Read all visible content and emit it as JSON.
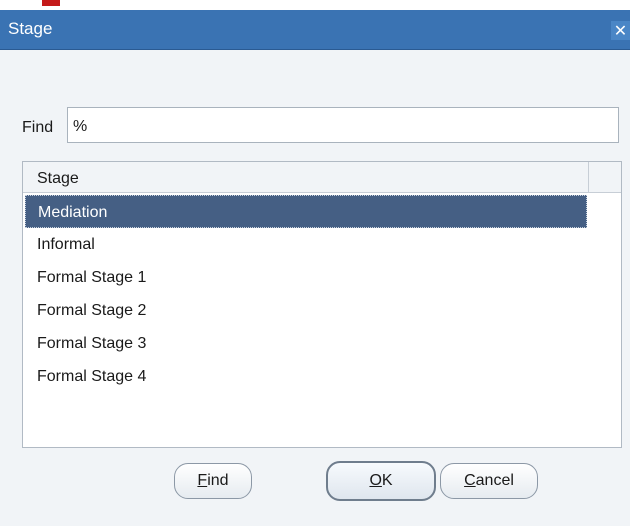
{
  "dialog": {
    "title": "Stage"
  },
  "search": {
    "label": "Find",
    "value": "%"
  },
  "list": {
    "column_header": "Stage",
    "items": [
      "Mediation",
      "Informal",
      "Formal Stage 1",
      "Formal Stage 2",
      "Formal Stage 3",
      "Formal Stage 4"
    ],
    "selected_index": 0
  },
  "buttons": {
    "find": {
      "mnemonic": "F",
      "rest": "ind"
    },
    "ok": {
      "mnemonic": "O",
      "rest": "K"
    },
    "cancel": {
      "mnemonic": "C",
      "rest": "ancel"
    }
  },
  "colors": {
    "title_bar": "#3a73b3",
    "selection": "#455f84",
    "dialog_bg": "#f1f4f7"
  },
  "icons": {
    "close": "close-icon"
  }
}
